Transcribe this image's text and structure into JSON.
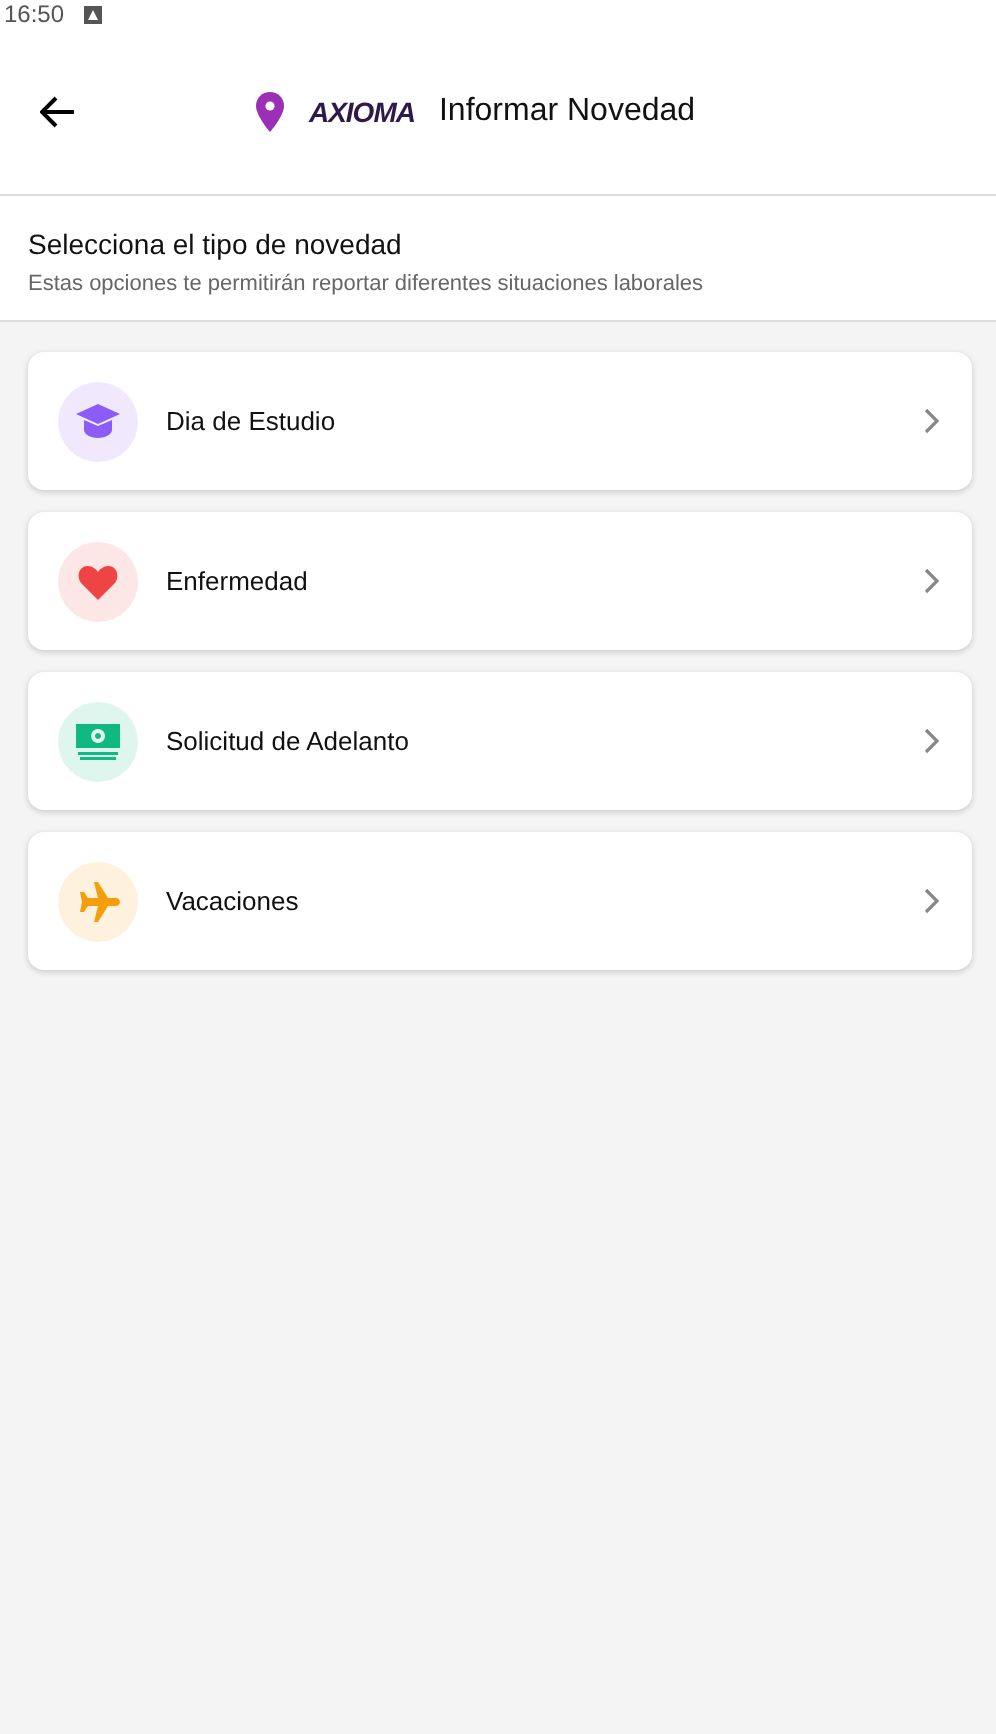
{
  "status_bar": {
    "time": "16:50"
  },
  "header": {
    "logo": "AXIOMA",
    "title": "Informar Novedad"
  },
  "intro": {
    "heading": "Selecciona el tipo de novedad",
    "subtitle": "Estas opciones te permitirán reportar diferentes situaciones laborales"
  },
  "options": [
    {
      "kind": "study",
      "label": "Dia de Estudio",
      "color": "#8b5cf6"
    },
    {
      "kind": "health",
      "label": "Enfermedad",
      "color": "#ef4444"
    },
    {
      "kind": "money",
      "label": "Solicitud de Adelanto",
      "color": "#10b981"
    },
    {
      "kind": "travel",
      "label": "Vacaciones",
      "color": "#f59e0b"
    }
  ]
}
